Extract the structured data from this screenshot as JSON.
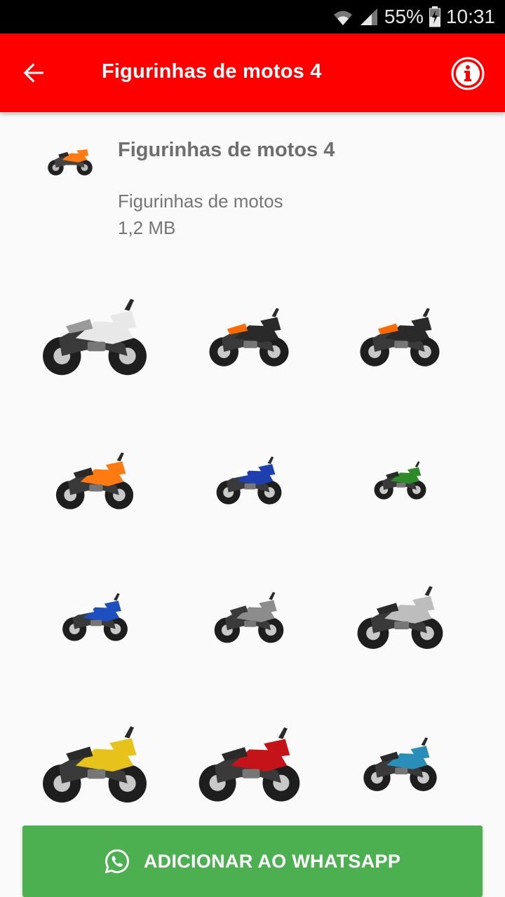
{
  "status_bar": {
    "battery_percent": "55%",
    "time": "10:31",
    "icons": [
      "wifi-icon",
      "signal-icon",
      "battery-charging-icon"
    ]
  },
  "app_bar": {
    "title": "Figurinhas de motos 4",
    "back_icon": "arrow-left-icon",
    "info_icon": "info-icon",
    "background": "#ff0000"
  },
  "pack": {
    "name": "Figurinhas de motos 4",
    "publisher": "Figurinhas de motos",
    "size": "1,2 MB"
  },
  "stickers": [
    {
      "icon": "motorcycle-sticker",
      "body": "#e8e8e8",
      "accent": "#9a9a9a"
    },
    {
      "icon": "motorcycle-sticker",
      "body": "#2a2a2a",
      "accent": "#ff6a00"
    },
    {
      "icon": "motorcycle-sticker",
      "body": "#2a2a2a",
      "accent": "#ff6a00"
    },
    {
      "icon": "motorcycle-sticker",
      "body": "#ff7a10",
      "accent": "#2a2a2a"
    },
    {
      "icon": "motorcycle-sticker",
      "body": "#1e3fb0",
      "accent": "#ffffff"
    },
    {
      "icon": "motorcycle-sticker",
      "body": "#2f8a2a",
      "accent": "#2a2a2a"
    },
    {
      "icon": "motorcycle-sticker",
      "body": "#1e4fc0",
      "accent": "#ffffff"
    },
    {
      "icon": "motorcycle-sticker",
      "body": "#8c8c8c",
      "accent": "#3a3a3a"
    },
    {
      "icon": "motorcycle-sticker",
      "body": "#bdbdbd",
      "accent": "#2a2a2a"
    },
    {
      "icon": "motorcycle-sticker",
      "body": "#e6c21a",
      "accent": "#2a2a2a"
    },
    {
      "icon": "motorcycle-sticker",
      "body": "#c4141a",
      "accent": "#2a2a2a"
    },
    {
      "icon": "motorcycle-sticker",
      "body": "#2a8fb8",
      "accent": "#2a2a2a"
    }
  ],
  "add_button": {
    "label": "ADICIONAR AO WHATSAPP",
    "icon": "whatsapp-icon",
    "background": "#4caf50"
  }
}
